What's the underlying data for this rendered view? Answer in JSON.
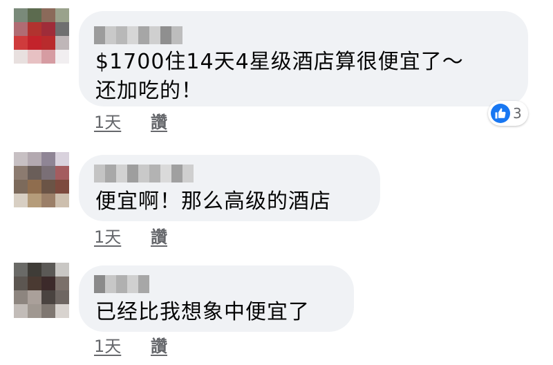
{
  "comments": [
    {
      "text_lines": [
        "$1700住14天4星级酒店算很便宜了～",
        "还加吃的！"
      ],
      "time": "1天",
      "like_label": "讚",
      "reactions": {
        "icon": "thumbs-up-icon",
        "count": "3"
      }
    },
    {
      "text_lines": [
        "便宜啊！那么高级的酒店"
      ],
      "time": "1天",
      "like_label": "讚"
    },
    {
      "text_lines": [
        "已经比我想象中便宜了"
      ],
      "time": "1天",
      "like_label": "讚"
    }
  ],
  "colors": {
    "bubble": "#f0f2f5",
    "meta_text": "#65676b",
    "like_blue": "#1877f2",
    "avatar1": [
      "#7a8a7a",
      "#5c6b4f",
      "#8b6a5a",
      "#9aa28c",
      "#b06c73",
      "#b1332f",
      "#9f2c39",
      "#6f6f70",
      "#cf3b3c",
      "#c3232b",
      "#b92b2d",
      "#bfb6b8",
      "#e8e0df",
      "#e7c1c3",
      "#d69ca2",
      "#f1eef0"
    ],
    "avatar2": [
      "#c7c0c3",
      "#b3a9b0",
      "#8f8595",
      "#d9d2dd",
      "#8c7b70",
      "#6a5e59",
      "#7a6f76",
      "#a45c5f",
      "#7c6a5b",
      "#8f6d4e",
      "#6b5446",
      "#7d4a3e",
      "#d8cfc3",
      "#b59c7a",
      "#9b7f68",
      "#cdbfae"
    ],
    "avatar3": [
      "#6a6a67",
      "#3f3c37",
      "#5b5956",
      "#c9c7c4",
      "#5c5651",
      "#4a3a32",
      "#3c2a2a",
      "#7b706a",
      "#8d857f",
      "#aaa09a",
      "#4a4340",
      "#6e6662",
      "#c2bcb8",
      "#a09891",
      "#7f7771",
      "#d8d3cf"
    ],
    "name1": [
      "#9c9c9c",
      "#c9c9c9",
      "#b8b8b8",
      "#d6d6d6",
      "#a6a6a6",
      "#cfcfcf",
      "#8f8f8f",
      "#bdbdbd"
    ],
    "name2": [
      "#c4c4c4",
      "#a8a8a8",
      "#d2d2d2",
      "#9e9e9e",
      "#c9c9c9",
      "#b3b3b3",
      "#dadada",
      "#a0a0a0",
      "#cfcfcf"
    ],
    "name3": [
      "#8a8a8a",
      "#c7c7c7",
      "#b0b0b0",
      "#d0d0d0",
      "#a7a7a7"
    ]
  }
}
